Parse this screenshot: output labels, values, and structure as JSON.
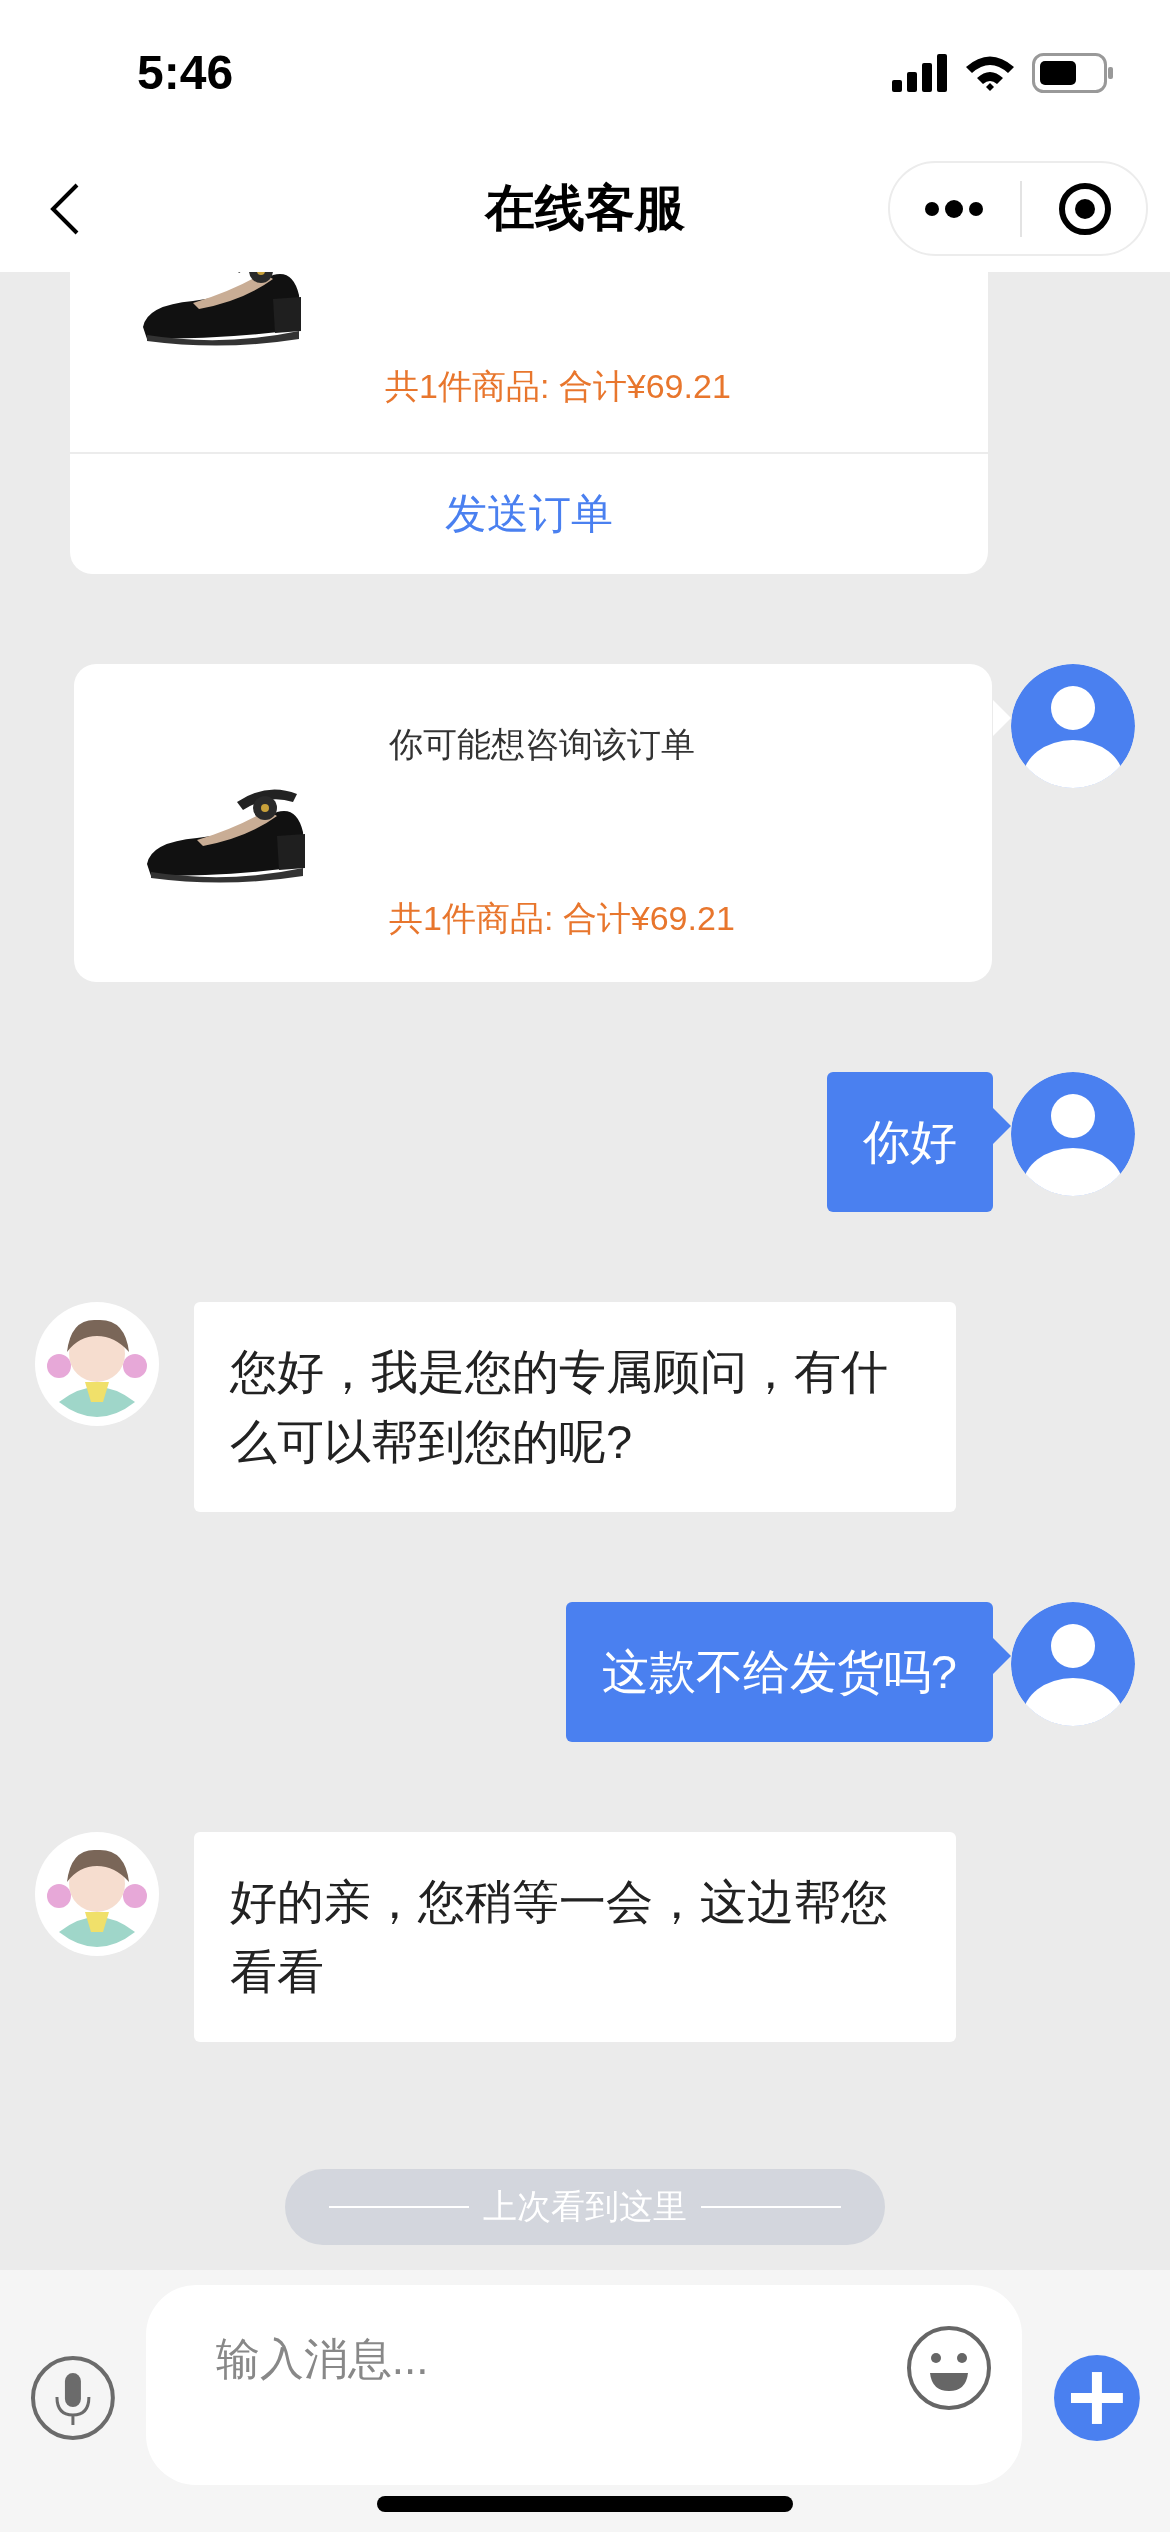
{
  "status_bar": {
    "time": "5:46"
  },
  "nav": {
    "title": "在线客服"
  },
  "messages": [
    {
      "kind": "order",
      "outgoing": true,
      "total": "共1件商品: 合计¥69.21",
      "action": "发送订单"
    },
    {
      "kind": "order",
      "outgoing": true,
      "caption": "你可能想咨询该订单",
      "total": "共1件商品: 合计¥69.21"
    },
    {
      "kind": "text",
      "outgoing": true,
      "text": "你好"
    },
    {
      "kind": "text",
      "outgoing": false,
      "text": "您好，我是您的专属顾问，有什么可以帮到您的呢?"
    },
    {
      "kind": "text",
      "outgoing": true,
      "text": "这款不给发货吗?"
    },
    {
      "kind": "text",
      "outgoing": false,
      "text": "好的亲，您稍等一会，这边帮您看看"
    }
  ],
  "divider": {
    "text": "上次看到这里"
  },
  "composer": {
    "placeholder": "输入消息..."
  }
}
